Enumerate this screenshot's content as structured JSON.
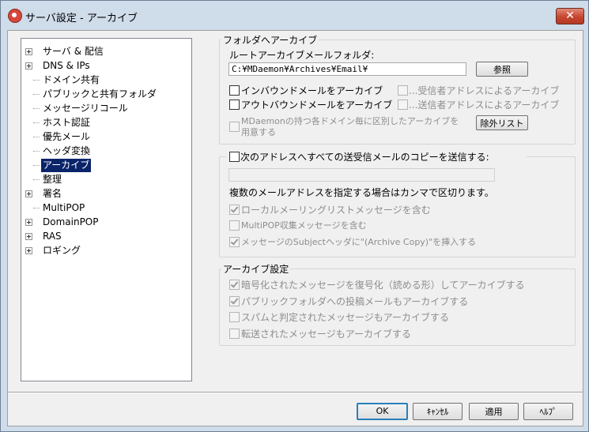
{
  "window": {
    "title": "サーバ設定 - アーカイブ",
    "close_glyph": "✕"
  },
  "tree": {
    "items": [
      {
        "label": "サーバ & 配信",
        "expandable": true,
        "selected": false
      },
      {
        "label": "DNS & IPs",
        "expandable": true,
        "selected": false
      },
      {
        "label": "ドメイン共有",
        "expandable": false,
        "selected": false
      },
      {
        "label": "パブリックと共有フォルダ",
        "expandable": false,
        "selected": false
      },
      {
        "label": "メッセージリコール",
        "expandable": false,
        "selected": false
      },
      {
        "label": "ホスト認証",
        "expandable": false,
        "selected": false
      },
      {
        "label": "優先メール",
        "expandable": false,
        "selected": false
      },
      {
        "label": "ヘッダ変換",
        "expandable": false,
        "selected": false
      },
      {
        "label": "アーカイブ",
        "expandable": false,
        "selected": true
      },
      {
        "label": "整理",
        "expandable": false,
        "selected": false
      },
      {
        "label": "署名",
        "expandable": true,
        "selected": false
      },
      {
        "label": "MultiPOP",
        "expandable": false,
        "selected": false
      },
      {
        "label": "DomainPOP",
        "expandable": true,
        "selected": false
      },
      {
        "label": "RAS",
        "expandable": true,
        "selected": false
      },
      {
        "label": "ロギング",
        "expandable": true,
        "selected": false
      }
    ]
  },
  "archive_folder": {
    "group_title": "フォルダへアーカイブ",
    "root_label": "ルートアーカイブメールフォルダ:",
    "root_value": "C:¥MDaemon¥Archives¥Email¥",
    "browse_label": "参照",
    "inbound_label": "インバウンドメールをアーカイブ",
    "inbound_checked": false,
    "by_recipient_label": "...受信者アドレスによるアーカイブ",
    "by_recipient_checked": false,
    "outbound_label": "アウトバウンドメールをアーカイブ",
    "outbound_checked": false,
    "by_sender_label": "...送信者アドレスによるアーカイブ",
    "by_sender_checked": false,
    "per_domain_line1": "MDaemonの持つ各ドメイン毎に区別したアーカイブを",
    "per_domain_line2": "用意する",
    "per_domain_checked": false,
    "exclude_label": "除外リスト"
  },
  "copy_section": {
    "send_copy_label": "次のアドレスへすべての送受信メールのコピーを送信する:",
    "send_copy_checked": false,
    "address_value": "",
    "hint": "複数のメールアドレスを指定する場合はカンマで区切ります。",
    "include_list_label": "ローカルメーリングリストメッセージを含む",
    "include_list_checked": true,
    "include_multipop_label": "MultiPOP収集メッセージを含む",
    "include_multipop_checked": false,
    "insert_subject_label": "メッセージのSubjectヘッダに\"(Archive Copy)\"を挿入する",
    "insert_subject_checked": true
  },
  "archive_settings": {
    "group_title": "アーカイブ設定",
    "decrypt_label": "暗号化されたメッセージを復号化（読める形）してアーカイブする",
    "decrypt_checked": true,
    "public_folder_label": "パブリックフォルダへの投稿メールもアーカイブする",
    "public_folder_checked": true,
    "spam_label": "スパムと判定されたメッセージもアーカイブする",
    "spam_checked": false,
    "forwarded_label": "転送されたメッセージもアーカイブする",
    "forwarded_checked": false
  },
  "footer": {
    "ok_label": "OK",
    "cancel_label": "ｷｬﾝｾﾙ",
    "apply_label": "適用",
    "help_label": "ﾍﾙﾌﾟ"
  }
}
